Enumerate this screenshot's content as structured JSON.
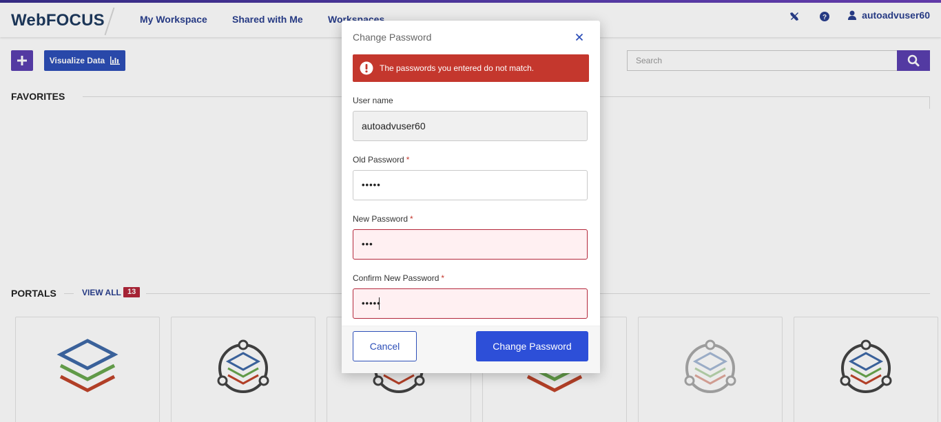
{
  "app": {
    "logo": "WebFOCUS",
    "nav": [
      "My Workspace",
      "Shared with Me",
      "Workspaces"
    ],
    "user": "autoadvuser60",
    "visualize_label": "Visualize Data",
    "search_placeholder": "Search",
    "favorites_title": "FAVORITES",
    "portals_title": "PORTALS",
    "view_all": "VIEW ALL",
    "portals_count": "13"
  },
  "modal": {
    "title": "Change Password",
    "alert": "The passwords you entered do not match.",
    "username_label": "User name",
    "username_value": "autoadvuser60",
    "old_label": "Old Password",
    "old_value": "•••••",
    "new_label": "New Password",
    "new_value": "•••",
    "confirm_label": "Confirm New Password",
    "confirm_value": "•••••",
    "required_mark": "*",
    "cancel_label": "Cancel",
    "submit_label": "Change Password"
  },
  "colors": {
    "brand_purple": "#5b3fb0",
    "brand_blue": "#2d4fb8",
    "error_red": "#c4372d",
    "error_field_bg": "#fff0f2"
  }
}
